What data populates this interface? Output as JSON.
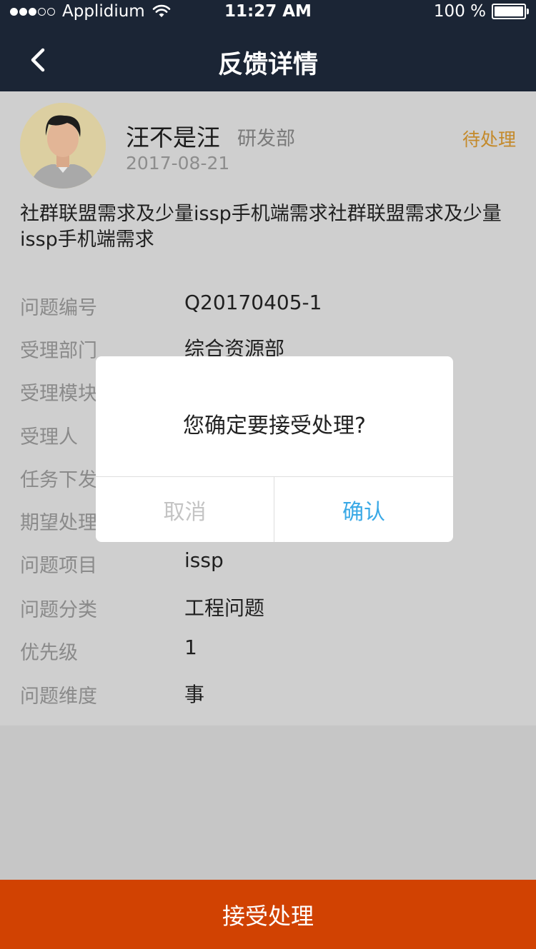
{
  "status_bar": {
    "carrier": "Applidium",
    "time": "11:27 AM",
    "battery": "100 %",
    "signal_icon": "signal-dots-icon",
    "wifi_icon": "wifi-icon",
    "battery_icon": "battery-icon"
  },
  "nav": {
    "back_icon": "chevron-left-icon",
    "title": "反馈详情"
  },
  "profile": {
    "avatar_icon": "user-avatar",
    "name": "汪不是汪",
    "department": "研发部",
    "date": "2017-08-21",
    "status": "待处理",
    "status_color": "#c48a2b"
  },
  "description": "社群联盟需求及少量issp手机端需求社群联盟需求及少量issp手机端需求",
  "details": [
    {
      "label": "问题编号",
      "value": "Q20170405-1"
    },
    {
      "label": "受理部门",
      "value": "综合资源部"
    },
    {
      "label": "受理模块",
      "value": ""
    },
    {
      "label": "受理人",
      "value": ""
    },
    {
      "label": "任务下发",
      "value": ""
    },
    {
      "label": "期望处理",
      "value": ""
    },
    {
      "label": "问题项目",
      "value": "issp"
    },
    {
      "label": "问题分类",
      "value": "工程问题"
    },
    {
      "label": "优先级",
      "value": "1"
    },
    {
      "label": "问题维度",
      "value": "事"
    }
  ],
  "modal": {
    "message": "您确定要接受处理?",
    "cancel_label": "取消",
    "confirm_label": "确认",
    "confirm_color": "#3aa9e6"
  },
  "accept_button": {
    "label": "接受处理",
    "color": "#d14202"
  }
}
